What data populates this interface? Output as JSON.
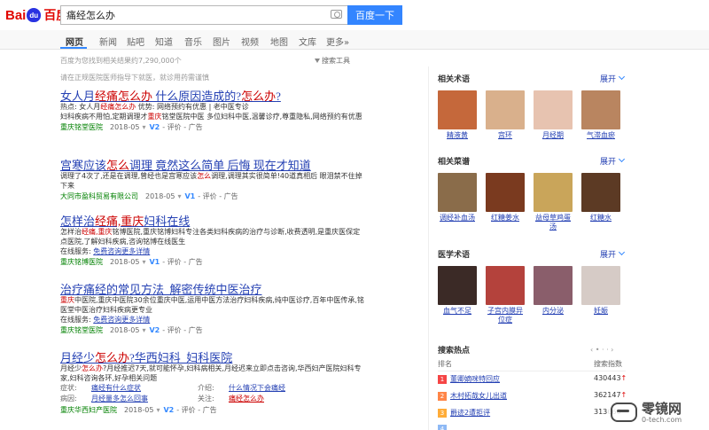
{
  "header": {
    "logo_latin": "Bai",
    "logo_cn": "百度",
    "search_value": "痛经怎么办",
    "search_button": "百度一下"
  },
  "tabs": [
    "网页",
    "新闻",
    "贴吧",
    "知道",
    "音乐",
    "图片",
    "视频",
    "地图",
    "文库",
    "更多»"
  ],
  "stats": "百度为您找到相关结果约7,290,000个",
  "search_tools": "搜索工具",
  "notice": "请在正规医院医师指导下就医，就诊用药需谨慎",
  "results": [
    {
      "title_a": "女人月",
      "title_hl1": "经痛怎么办",
      "title_b": " 什么原因造成的?",
      "title_hl2": "怎么办",
      "title_c": "?",
      "line1_a": "热点: 女人月",
      "line1_hl": "经痛怎么办",
      "line1_b": "   优势: 网络预约有优惠 | 老中医专诊",
      "body_a": "妇科疾病不用怕,定期调理才",
      "body_hl": "重庆",
      "body_b": "铭堂医院中医 多位妇科中医,温馨诊疗,尊重隐私,网络预约有优惠",
      "source": "重庆铭堂医院",
      "date": "2018-05",
      "vip": "V2",
      "tail": "- 评价 - 广告"
    },
    {
      "title_a": "宫寒应该",
      "title_hl1": "怎么",
      "title_b": "调理 竟然这么简单 后悔 现在才知道",
      "title_hl2": "",
      "title_c": "",
      "body_a": "调理了4次了,还是在调理,曾经也是宫寒应该",
      "body_hl": "怎么",
      "body_b": "调理,调理其实很简单!40道真相后 眼泪禁不住掉下来",
      "source": "大同市盈科贸易有限公司",
      "date": "2018-05",
      "vip": "V1",
      "tail": "- 评价 - 广告"
    },
    {
      "title_a": "怎样治",
      "title_hl1": "经痛,重庆",
      "title_b": "妇科在线",
      "title_hl2": "",
      "title_c": "",
      "body_a": "怎样治",
      "body_hl": "经痛,重庆",
      "body_b": "铭博医院,重庆铭博妇科专注各类妇科疾病的治疗与诊断,收费透明,是重庆医保定点医院,了解妇科疾病,咨询铭博在线医生",
      "service_label": "在线服务:",
      "service_link": "免费咨询更多详情",
      "source": "重庆铭博医院",
      "date": "2018-05",
      "vip": "V1",
      "tail": "- 评价 - 广告"
    },
    {
      "title_a": "治疗痛经的常见方法_解密传统中医治疗",
      "title_hl1": "",
      "title_b": "",
      "title_hl2": "",
      "title_c": "",
      "body_a": "",
      "body_hl": "重庆",
      "body_b": "中医院,重庆中医院30余位重庆中医,运用中医方法治疗妇科疾病,纯中医诊疗,百年中医传承,铭医堂中医治疗妇科疾病更专业",
      "service_label": "在线服务:",
      "service_link": "免费咨询更多详情",
      "source": "重庆铭堂医院",
      "date": "2018-05",
      "vip": "V2",
      "tail": "- 评价 - 广告"
    },
    {
      "title_a": "月经少",
      "title_hl1": "怎么办",
      "title_b": "?华西妇科_妇科医院",
      "title_hl2": "",
      "title_c": "",
      "body_a": "月经少",
      "body_hl": "怎么办",
      "body_b": "?月经推迟7天,就可能怀孕,妇科病相关,月经迟来立即点击咨询,华西妇产医院妇科专家,妇科咨询各环,好孕相关问题",
      "grid": [
        {
          "label": "症状:",
          "link": "痛经有什么症状",
          "label2": "介绍:",
          "link2": "什么情况下会痛经"
        },
        {
          "label": "病因:",
          "link": "月经量多怎么回事",
          "label2": "关注:",
          "link2": "痛经怎么办"
        }
      ],
      "source": "重庆华西妇产医院",
      "date": "2018-05",
      "vip": "V2",
      "tail": "- 评价 - 广告"
    }
  ],
  "side": {
    "expand_label": "展开",
    "sections": [
      {
        "title": "相关术语",
        "items": [
          {
            "label": "精液黄",
            "color": "#c5683b"
          },
          {
            "label": "宫环",
            "color": "#d9b08c"
          },
          {
            "label": "月经期",
            "color": "#e7c3b0"
          },
          {
            "label": "气滞血瘀",
            "color": "#b98560"
          }
        ]
      },
      {
        "title": "相关菜谱",
        "items": [
          {
            "label": "调经补血汤",
            "color": "#8a6c4a"
          },
          {
            "label": "红糖姜水",
            "color": "#7a3a1f"
          },
          {
            "label": "益母草鸡蛋汤",
            "color": "#c9a55a"
          },
          {
            "label": "红糖水",
            "color": "#5c3a24"
          }
        ]
      },
      {
        "title": "医学术语",
        "items": [
          {
            "label": "血气不足",
            "color": "#3b2a26"
          },
          {
            "label": "子宫内膜异位症",
            "color": "#b4423c"
          },
          {
            "label": "内分泌",
            "color": "#8a5e6b"
          },
          {
            "label": "妊娠",
            "color": "#d6cbc6"
          }
        ]
      }
    ],
    "hot": {
      "title": "搜索热点",
      "col_rank": "排名",
      "col_index": "搜索指数",
      "rows": [
        {
          "rank": "1",
          "query": "董卿嫡咪特回应",
          "value": "430443",
          "color": "#f54545"
        },
        {
          "rank": "2",
          "query": "木村拓哉女儿出道",
          "value": "362147",
          "color": "#ff8547"
        },
        {
          "rank": "3",
          "query": "爵迹2遭拒评",
          "value": "313666",
          "color": "#ffac38"
        },
        {
          "rank": "4",
          "query": "",
          "value": "",
          "color": "#8eb9f5"
        }
      ]
    }
  },
  "watermark": {
    "big": "零镜网",
    "small": "0-tech.com"
  }
}
